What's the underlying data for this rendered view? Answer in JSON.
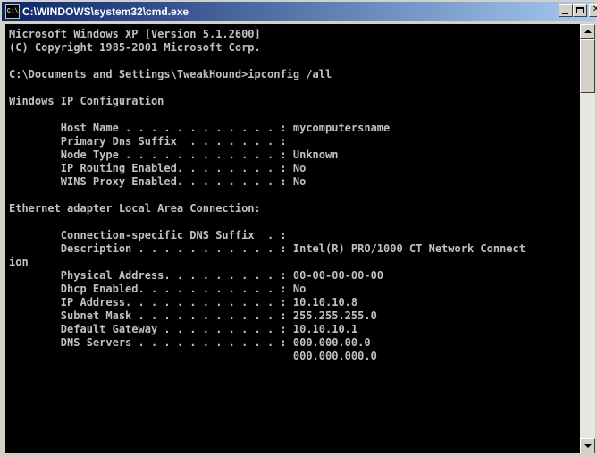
{
  "window": {
    "title": "C:\\WINDOWS\\system32\\cmd.exe",
    "icon_label": "C:\\"
  },
  "console": {
    "lines": [
      "Microsoft Windows XP [Version 5.1.2600]",
      "(C) Copyright 1985-2001 Microsoft Corp.",
      "",
      "C:\\Documents and Settings\\TweakHound>ipconfig /all",
      "",
      "Windows IP Configuration",
      "",
      "        Host Name . . . . . . . . . . . . : mycomputersname",
      "        Primary Dns Suffix  . . . . . . . :",
      "        Node Type . . . . . . . . . . . . : Unknown",
      "        IP Routing Enabled. . . . . . . . : No",
      "        WINS Proxy Enabled. . . . . . . . : No",
      "",
      "Ethernet adapter Local Area Connection:",
      "",
      "        Connection-specific DNS Suffix  . :",
      "        Description . . . . . . . . . . . : Intel(R) PRO/1000 CT Network Connect",
      "ion",
      "        Physical Address. . . . . . . . . : 00-00-00-00-00",
      "        Dhcp Enabled. . . . . . . . . . . : No",
      "        IP Address. . . . . . . . . . . . : 10.10.10.8",
      "        Subnet Mask . . . . . . . . . . . : 255.255.255.0",
      "        Default Gateway . . . . . . . . . : 10.10.10.1",
      "        DNS Servers . . . . . . . . . . . : 000.000.00.0",
      "                                            000.000.000.0"
    ]
  },
  "icons": {
    "app": "cmd-icon",
    "minimize": "minimize-icon",
    "maximize": "maximize-icon",
    "close": "close-icon",
    "scroll_up": "arrow-up-icon",
    "scroll_down": "arrow-down-icon"
  },
  "colors": {
    "console_background": "#000000",
    "console_text": "#c0c0c0",
    "titlebar_start": "#0a246a",
    "titlebar_end": "#a6caf0"
  }
}
